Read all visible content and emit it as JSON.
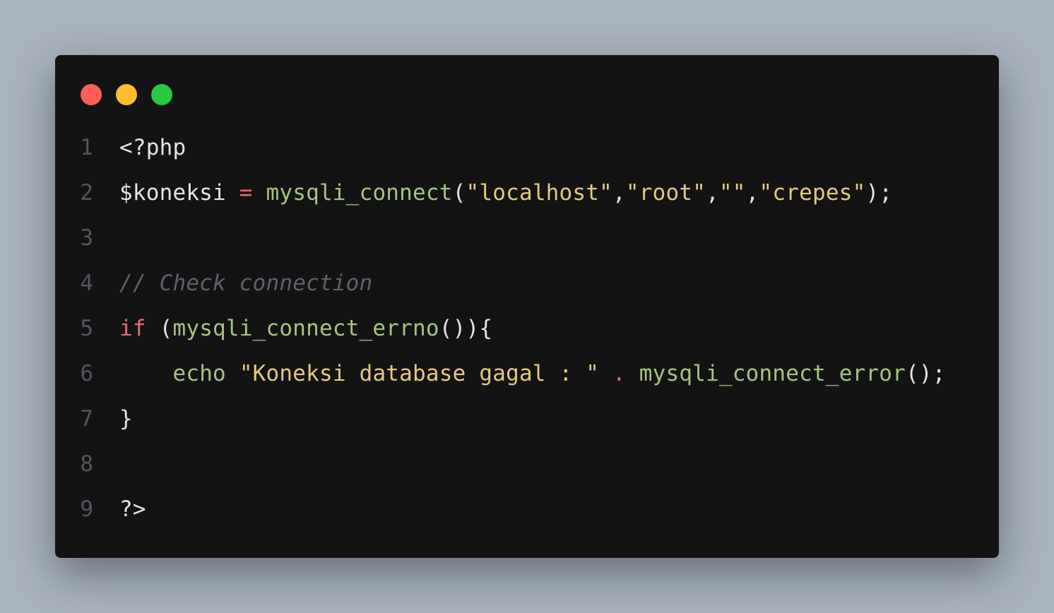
{
  "window": {
    "colors": {
      "background": "#a9b3bf",
      "panel": "#131313",
      "close": "#ff5f57",
      "minimize": "#febc2e",
      "maximize": "#28c840"
    }
  },
  "code": {
    "lines": [
      {
        "number": "1",
        "tokens": [
          {
            "type": "plain",
            "text": "<?php"
          }
        ]
      },
      {
        "number": "2",
        "tokens": [
          {
            "type": "plain",
            "text": "$koneksi "
          },
          {
            "type": "op",
            "text": "="
          },
          {
            "type": "plain",
            "text": " "
          },
          {
            "type": "fn",
            "text": "mysqli_connect"
          },
          {
            "type": "plain",
            "text": "("
          },
          {
            "type": "str",
            "text": "\"localhost\""
          },
          {
            "type": "plain",
            "text": ","
          },
          {
            "type": "str",
            "text": "\"root\""
          },
          {
            "type": "plain",
            "text": ","
          },
          {
            "type": "str",
            "text": "\"\""
          },
          {
            "type": "plain",
            "text": ","
          },
          {
            "type": "str",
            "text": "\"crepes\""
          },
          {
            "type": "plain",
            "text": ");"
          }
        ]
      },
      {
        "number": "3",
        "tokens": []
      },
      {
        "number": "4",
        "tokens": [
          {
            "type": "cm",
            "text": "// Check connection"
          }
        ]
      },
      {
        "number": "5",
        "tokens": [
          {
            "type": "kw",
            "text": "if"
          },
          {
            "type": "plain",
            "text": " ("
          },
          {
            "type": "fn",
            "text": "mysqli_connect_errno"
          },
          {
            "type": "plain",
            "text": "()){"
          }
        ]
      },
      {
        "number": "6",
        "tokens": [
          {
            "type": "plain",
            "text": "    "
          },
          {
            "type": "fn",
            "text": "echo"
          },
          {
            "type": "plain",
            "text": " "
          },
          {
            "type": "str",
            "text": "\"Koneksi database gagal : \""
          },
          {
            "type": "plain",
            "text": " "
          },
          {
            "type": "op",
            "text": "."
          },
          {
            "type": "plain",
            "text": " "
          },
          {
            "type": "fn",
            "text": "mysqli_connect_error"
          },
          {
            "type": "plain",
            "text": "();"
          }
        ]
      },
      {
        "number": "7",
        "tokens": [
          {
            "type": "plain",
            "text": "}"
          }
        ]
      },
      {
        "number": "8",
        "tokens": []
      },
      {
        "number": "9",
        "tokens": [
          {
            "type": "plain",
            "text": "?>"
          }
        ]
      }
    ]
  }
}
